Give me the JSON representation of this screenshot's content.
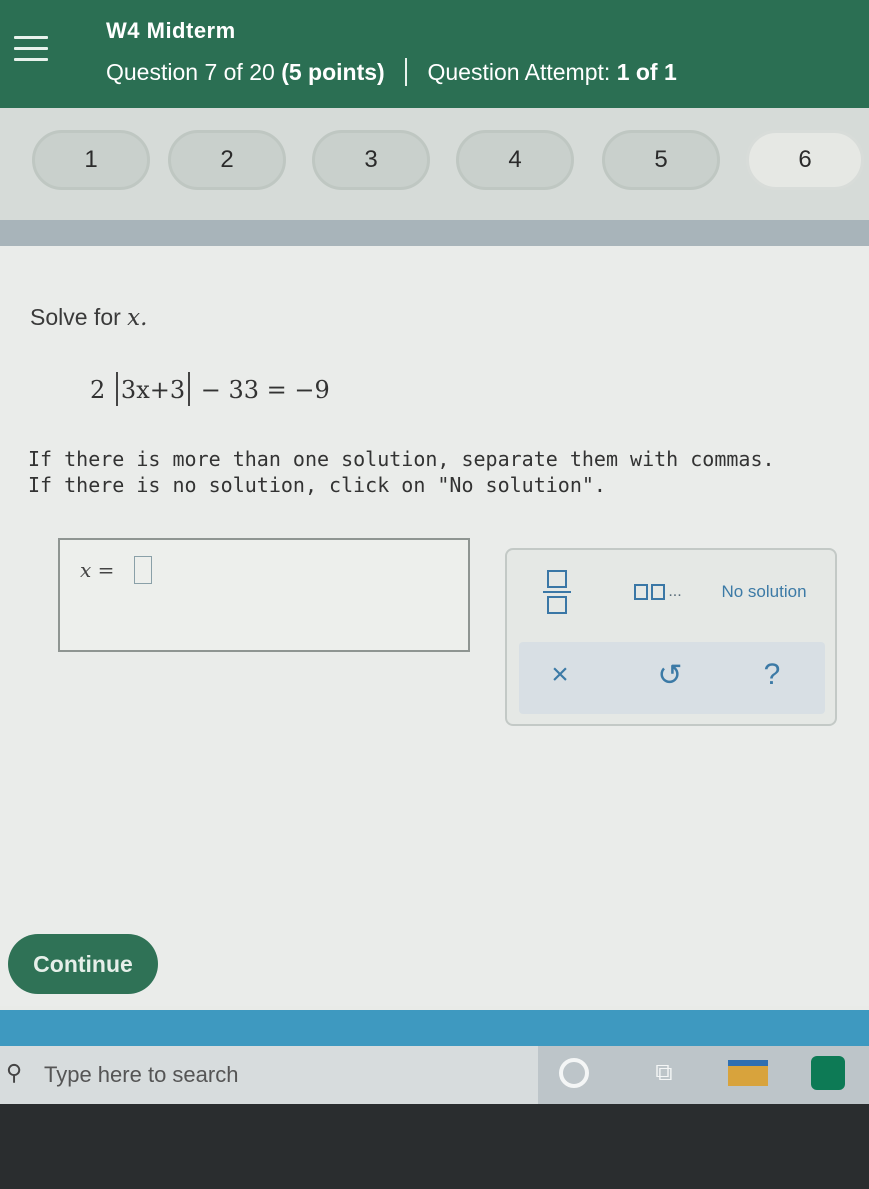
{
  "header": {
    "course_title": "W4 Midterm",
    "question_label": "Question 7 of 20",
    "points": "(5 points)",
    "attempt_label": "Question Attempt:",
    "attempt_value": "1 of 1"
  },
  "question_nav": [
    "1",
    "2",
    "3",
    "4",
    "5",
    "6"
  ],
  "problem": {
    "prompt_prefix": "Solve for ",
    "variable": "x.",
    "equation_lead": "2",
    "equation_abs": "3x+3",
    "equation_tail": "− 33 = −9",
    "instruction_line1": "If there is more than one solution, separate them with commas.",
    "instruction_line2": "If there is no solution, click on \"No solution\"."
  },
  "answer": {
    "label": "x =",
    "value": ""
  },
  "palette": {
    "list_ellipsis": "...",
    "no_solution": "No solution",
    "clear_symbol": "×",
    "undo_symbol": "↺",
    "help_symbol": "?"
  },
  "continue_label": "Continue",
  "taskbar": {
    "search_placeholder": "Type here to search",
    "task_view_symbol": "⧉"
  }
}
